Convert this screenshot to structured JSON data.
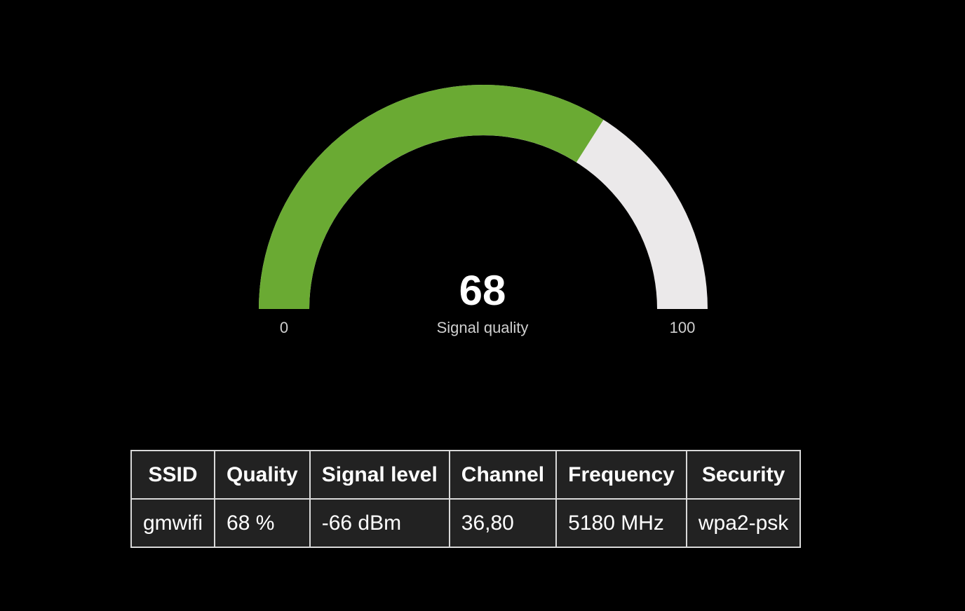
{
  "gauge": {
    "value": 68,
    "value_text": "68",
    "label": "Signal quality",
    "min": 0,
    "min_text": "0",
    "max": 100,
    "max_text": "100",
    "colors": {
      "fill": "#6aaa33",
      "track": "#ebe9ea"
    }
  },
  "table": {
    "headers": [
      "SSID",
      "Quality",
      "Signal level",
      "Channel",
      "Frequency",
      "Security"
    ],
    "rows": [
      [
        "gmwifi",
        "68 %",
        "-66 dBm",
        "36,80",
        "5180 MHz",
        "wpa2-psk"
      ]
    ]
  }
}
